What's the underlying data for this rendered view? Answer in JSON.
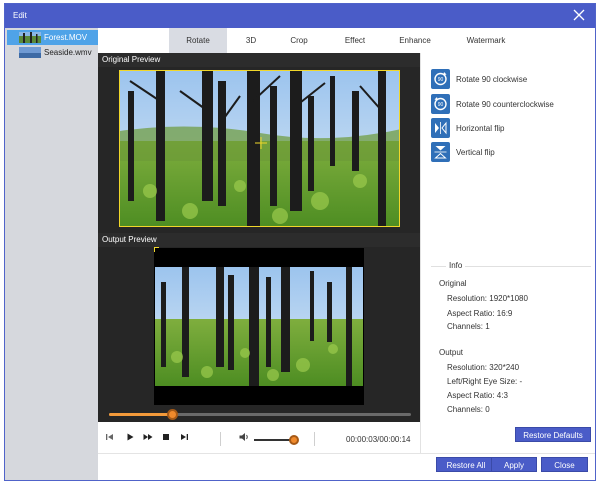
{
  "window": {
    "title": "Edit"
  },
  "files": [
    {
      "name": "Forest.MOV",
      "selected": true
    },
    {
      "name": "Seaside.wmv",
      "selected": false
    }
  ],
  "tabs": [
    {
      "label": "Rotate",
      "active": true
    },
    {
      "label": "3D",
      "active": false
    },
    {
      "label": "Crop",
      "active": false
    },
    {
      "label": "Effect",
      "active": false
    },
    {
      "label": "Enhance",
      "active": false
    },
    {
      "label": "Watermark",
      "active": false
    }
  ],
  "preview": {
    "original_label": "Original Preview",
    "output_label": "Output Preview"
  },
  "player": {
    "seek_progress": 0.21,
    "volume_level": 1.0,
    "timecode": "00:00:03/00:00:14",
    "icons": [
      "skip-back-icon",
      "play-icon",
      "fast-forward-icon",
      "stop-icon",
      "skip-forward-icon",
      "volume-icon"
    ]
  },
  "rotate": {
    "actions": [
      {
        "label": "Rotate 90 clockwise",
        "icon": "rotate-cw-icon"
      },
      {
        "label": "Rotate 90 counterclockwise",
        "icon": "rotate-ccw-icon"
      },
      {
        "label": "Horizontal flip",
        "icon": "horizontal-flip-icon"
      },
      {
        "label": "Vertical flip",
        "icon": "vertical-flip-icon"
      }
    ]
  },
  "info": {
    "title": "Info",
    "original_heading": "Original",
    "original_resolution": "Resolution: 1920*1080",
    "original_aspect": "Aspect Ratio: 16:9",
    "original_channels": "Channels: 1",
    "output_heading": "Output",
    "output_resolution": "Resolution: 320*240",
    "output_eye": "Left/Right Eye Size: -",
    "output_aspect": "Aspect Ratio: 4:3",
    "output_channels": "Channels: 0"
  },
  "buttons": {
    "restore_defaults": "Restore Defaults",
    "restore_all": "Restore All",
    "apply": "Apply",
    "close": "Close"
  },
  "colors": {
    "accent": "#4a5cc8",
    "selected_file": "#4fa3e8",
    "crop_frame": "#f1d72a",
    "slider_knob": "#f08a2c",
    "action_icon": "#2f6fb8"
  }
}
